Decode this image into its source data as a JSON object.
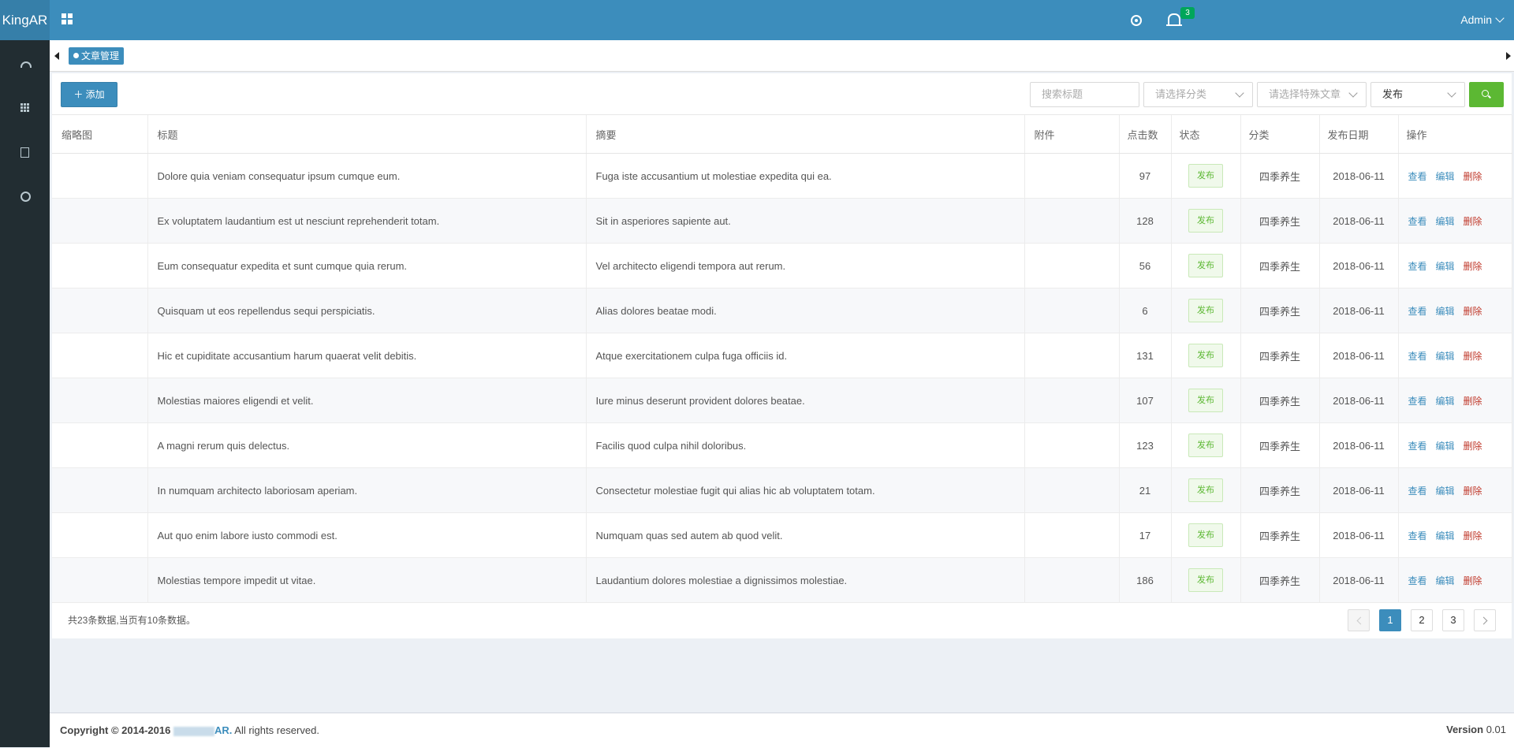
{
  "header": {
    "brand": "KingAR",
    "notification_count": "3",
    "user": "Admin"
  },
  "sidebar": {
    "items": [
      {
        "icon": "dashboard-icon"
      },
      {
        "icon": "apps-grid-icon"
      },
      {
        "icon": "document-icon"
      },
      {
        "icon": "user-circle-icon"
      }
    ]
  },
  "tabs": {
    "active": "文章管理"
  },
  "toolbar": {
    "add_label": "＋ 添加",
    "search_placeholder": "搜索标题",
    "category_placeholder": "请选择分类",
    "special_placeholder": "请选择特殊文章",
    "status_selected": "发布"
  },
  "table": {
    "headers": [
      "缩略图",
      "标题",
      "摘要",
      "附件",
      "点击数",
      "状态",
      "分类",
      "发布日期",
      "操作"
    ],
    "actions": {
      "view": "查看",
      "edit": "编辑",
      "delete": "删除"
    },
    "rows": [
      {
        "title": "Dolore quia veniam consequatur ipsum cumque eum.",
        "summary": "Fuga iste accusantium ut molestiae expedita qui ea.",
        "clicks": "97",
        "status": "发布",
        "category": "四季养生",
        "date": "2018-06-11"
      },
      {
        "title": "Ex voluptatem laudantium est ut nesciunt reprehenderit totam.",
        "summary": "Sit in asperiores sapiente aut.",
        "clicks": "128",
        "status": "发布",
        "category": "四季养生",
        "date": "2018-06-11"
      },
      {
        "title": "Eum consequatur expedita et sunt cumque quia rerum.",
        "summary": "Vel architecto eligendi tempora aut rerum.",
        "clicks": "56",
        "status": "发布",
        "category": "四季养生",
        "date": "2018-06-11"
      },
      {
        "title": "Quisquam ut eos repellendus sequi perspiciatis.",
        "summary": "Alias dolores beatae modi.",
        "clicks": "6",
        "status": "发布",
        "category": "四季养生",
        "date": "2018-06-11"
      },
      {
        "title": "Hic et cupiditate accusantium harum quaerat velit debitis.",
        "summary": "Atque exercitationem culpa fuga officiis id.",
        "clicks": "131",
        "status": "发布",
        "category": "四季养生",
        "date": "2018-06-11"
      },
      {
        "title": "Molestias maiores eligendi et velit.",
        "summary": "Iure minus deserunt provident dolores beatae.",
        "clicks": "107",
        "status": "发布",
        "category": "四季养生",
        "date": "2018-06-11"
      },
      {
        "title": "A magni rerum quis delectus.",
        "summary": "Facilis quod culpa nihil doloribus.",
        "clicks": "123",
        "status": "发布",
        "category": "四季养生",
        "date": "2018-06-11"
      },
      {
        "title": "In numquam architecto laboriosam aperiam.",
        "summary": "Consectetur molestiae fugit qui alias hic ab voluptatem totam.",
        "clicks": "21",
        "status": "发布",
        "category": "四季养生",
        "date": "2018-06-11"
      },
      {
        "title": "Aut quo enim labore iusto commodi est.",
        "summary": "Numquam quas sed autem ab quod velit.",
        "clicks": "17",
        "status": "发布",
        "category": "四季养生",
        "date": "2018-06-11"
      },
      {
        "title": "Molestias tempore impedit ut vitae.",
        "summary": "Laudantium dolores molestiae a dignissimos molestiae.",
        "clicks": "186",
        "status": "发布",
        "category": "四季养生",
        "date": "2018-06-11"
      }
    ]
  },
  "pagination": {
    "info": "共23条数据,当页有10条数据。",
    "pages": [
      "1",
      "2",
      "3"
    ],
    "current": "1"
  },
  "footer": {
    "copyright_prefix": "Copyright © 2014-2016",
    "brand_suffix": "AR.",
    "rights": "All rights reserved.",
    "version_label": "Version",
    "version_value": "0.01"
  },
  "colors": {
    "header": "#3c8dbc",
    "sidebar": "#222d32",
    "success": "#5cb833",
    "danger": "#c0392b"
  }
}
